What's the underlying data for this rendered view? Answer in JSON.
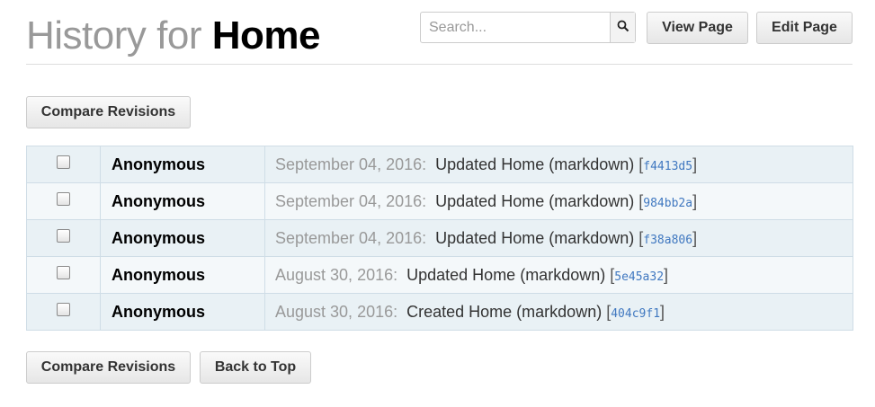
{
  "header": {
    "title_prefix": "History for",
    "page_name": "Home"
  },
  "search": {
    "placeholder": "Search..."
  },
  "actions": {
    "view_page": "View Page",
    "edit_page": "Edit Page"
  },
  "compare_top": "Compare Revisions",
  "revisions": [
    {
      "author": "Anonymous",
      "date": "September 04, 2016:",
      "message": "Updated Home (markdown)",
      "sha": "f4413d5"
    },
    {
      "author": "Anonymous",
      "date": "September 04, 2016:",
      "message": "Updated Home (markdown)",
      "sha": "984bb2a"
    },
    {
      "author": "Anonymous",
      "date": "September 04, 2016:",
      "message": "Updated Home (markdown)",
      "sha": "f38a806"
    },
    {
      "author": "Anonymous",
      "date": "August 30, 2016:",
      "message": "Updated Home (markdown)",
      "sha": "5e45a32"
    },
    {
      "author": "Anonymous",
      "date": "August 30, 2016:",
      "message": "Created Home (markdown)",
      "sha": "404c9f1"
    }
  ],
  "bottom": {
    "compare": "Compare Revisions",
    "back_to_top": "Back to Top"
  },
  "icons": {
    "search": "search-icon"
  },
  "colors": {
    "sha_link": "#4078c0",
    "row_odd": "#e9f1f5",
    "row_even": "#f4f8fa"
  }
}
